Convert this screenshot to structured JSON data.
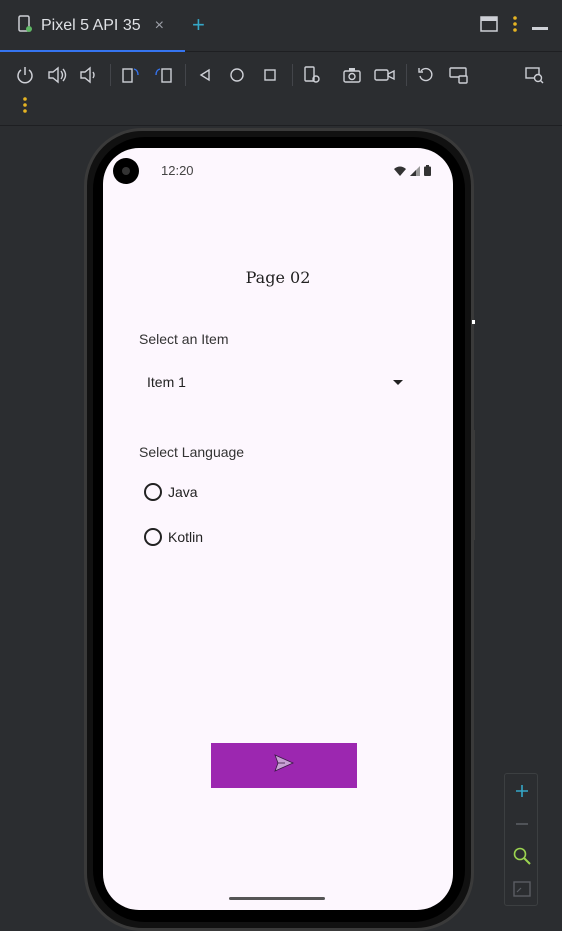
{
  "tab": {
    "title": "Pixel 5 API 35",
    "close": "×",
    "add": "+"
  },
  "device": {
    "status_time": "12:20",
    "page_title": "Page 02",
    "select_item_label": "Select an Item",
    "dropdown_value": "Item 1",
    "select_language_label": "Select Language",
    "languages": [
      "Java",
      "Kotlin"
    ],
    "accent_color": "#9c27b0"
  },
  "icons": {
    "tab": "device-icon",
    "toolbar": [
      "power-icon",
      "volume-up-icon",
      "volume-down-icon",
      "rotate-left-icon",
      "rotate-right-icon",
      "back-icon",
      "home-icon",
      "overview-icon",
      "device-settings-icon",
      "screenshot-icon",
      "screen-record-icon",
      "reset-icon",
      "keyboard-icon",
      "device-mirror-icon",
      "more-icon"
    ],
    "zoom": [
      "zoom-in-icon",
      "zoom-out-icon",
      "zoom-actual-icon",
      "fit-screen-icon"
    ]
  }
}
